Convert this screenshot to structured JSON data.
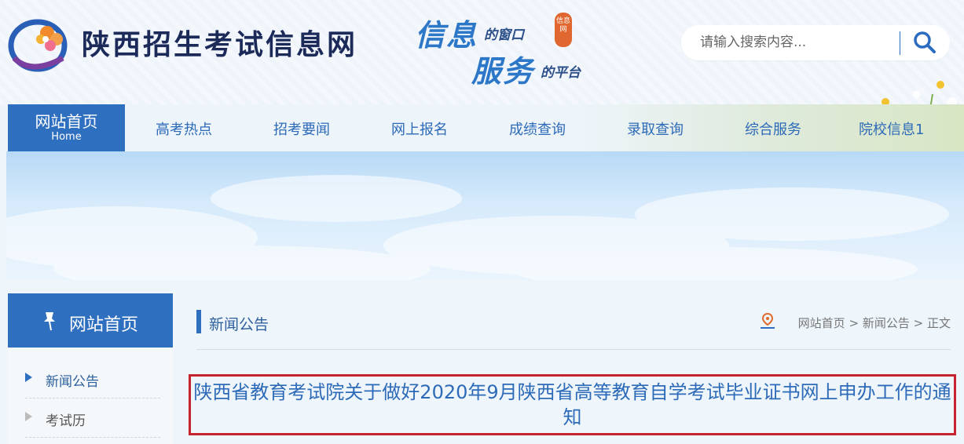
{
  "header": {
    "site_name": "陕西招生考试信息网",
    "slogan": {
      "line1_big": "信息",
      "line1_small": "的窗口",
      "line2_big": "服务",
      "line2_small": "的平台",
      "seal_text": "信息网"
    },
    "search": {
      "placeholder": "请输入搜索内容..."
    }
  },
  "nav": {
    "home_label": "网站首页",
    "home_sub": "Home",
    "items": [
      "高考热点",
      "招考要闻",
      "网上报名",
      "成绩查询",
      "录取查询",
      "综合服务",
      "院校信息1"
    ]
  },
  "sidebar": {
    "title": "网站首页",
    "items": [
      {
        "label": "新闻公告",
        "active": true
      },
      {
        "label": "考试历",
        "active": false
      }
    ]
  },
  "content": {
    "section_title": "新闻公告",
    "breadcrumb": [
      "网站首页",
      "新闻公告",
      "正文"
    ],
    "breadcrumb_sep": ">",
    "article_title": "陕西省教育考试院关于做好2020年9月陕西省高等教育自学考试毕业证书网上申办工作的通知"
  },
  "colors": {
    "primary_blue": "#2f6fc0",
    "link_blue": "#2d6ab8",
    "highlight_red": "#c8242f"
  }
}
